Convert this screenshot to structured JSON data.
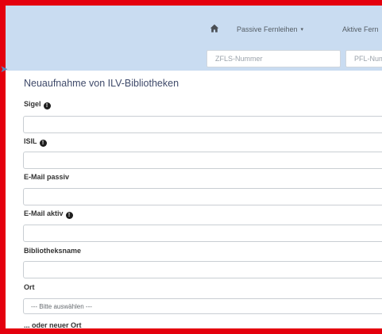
{
  "header": {
    "nav": {
      "passive_label": "Passive Fernleihen",
      "aktive_label": "Aktive Fern"
    },
    "zfls_placeholder": "ZFLS-Nummer",
    "pfl_placeholder": "PFL-Num"
  },
  "page": {
    "title": "Neuaufnahme von ILV-Bibliotheken"
  },
  "form": {
    "sigel_label": "Sigel",
    "isil_label": "ISIL",
    "email_passiv_label": "E-Mail passiv",
    "email_aktiv_label": "E-Mail aktiv",
    "bibliotheksname_label": "Bibliotheksname",
    "ort_label": "Ort",
    "ort_select_value": "--- Bitte auswählen ---",
    "neuer_ort_label": "... oder neuer Ort"
  },
  "colors": {
    "highlight_border": "#e4000e",
    "header_bg": "#c9dcf1"
  },
  "icons": {
    "home": "home-icon",
    "info": "info-icon",
    "arrow": "arrow-icon"
  }
}
